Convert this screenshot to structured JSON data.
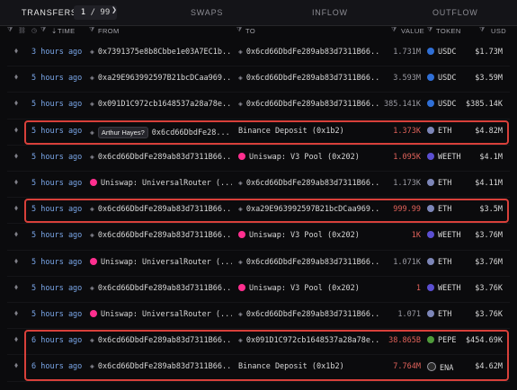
{
  "tabs": {
    "transfers": "TRANSFERS",
    "page_current": "1",
    "page_sep": " / ",
    "page_total": "99",
    "swaps": "SWAPS",
    "inflow": "INFLOW",
    "outflow": "OUTFLOW"
  },
  "header": {
    "time": "TIME",
    "from": "FROM",
    "to": "TO",
    "value": "VALUE",
    "token": "TOKEN",
    "usd": "USD"
  },
  "colors": {
    "link_blue": "#7aa6e8",
    "red": "#e0625a",
    "highlight": "#d8403a"
  },
  "rows": [
    {
      "time": "3 hours ago",
      "from": "0x7391375e8b8Cbbe1e03A7EC1b...",
      "from_tag": "",
      "from_icon": "",
      "to": "0x6cd66DbdFe289ab83d7311B66...",
      "to_icon": "",
      "value": "1.731M",
      "value_color": "grey",
      "token": "USDC",
      "token_icon": "usdc",
      "usd": "$1.73M"
    },
    {
      "time": "5 hours ago",
      "from": "0xa29E963992597B21bcDCaa969...",
      "from_tag": "",
      "from_icon": "",
      "to": "0x6cd66DbdFe289ab83d7311B66...",
      "to_icon": "",
      "value": "3.593M",
      "value_color": "grey",
      "token": "USDC",
      "token_icon": "usdc",
      "usd": "$3.59M"
    },
    {
      "time": "5 hours ago",
      "from": "0x091D1C972cb1648537a28a78e...",
      "from_tag": "",
      "from_icon": "",
      "to": "0x6cd66DbdFe289ab83d7311B66...",
      "to_icon": "",
      "value": "385.141K",
      "value_color": "grey",
      "token": "USDC",
      "token_icon": "usdc",
      "usd": "$385.14K"
    },
    {
      "time": "5 hours ago",
      "from": "0x6cd66DbdFe28...",
      "from_tag": "Arthur Hayes?",
      "from_icon": "",
      "to": "Binance Deposit (0x1b2)",
      "to_icon": "",
      "value": "1.373K",
      "value_color": "red",
      "token": "ETH",
      "token_icon": "eth",
      "usd": "$4.82M"
    },
    {
      "time": "5 hours ago",
      "from": "0x6cd66DbdFe289ab83d7311B66...",
      "from_tag": "",
      "from_icon": "",
      "to": "Uniswap: V3 Pool (0x202)",
      "to_icon": "uni",
      "value": "1.095K",
      "value_color": "red",
      "token": "WEETH",
      "token_icon": "weeth",
      "usd": "$4.1M"
    },
    {
      "time": "5 hours ago",
      "from": "Uniswap: UniversalRouter (...",
      "from_tag": "",
      "from_icon": "uni",
      "to": "0x6cd66DbdFe289ab83d7311B66...",
      "to_icon": "",
      "value": "1.173K",
      "value_color": "grey",
      "token": "ETH",
      "token_icon": "eth",
      "usd": "$4.11M"
    },
    {
      "time": "5 hours ago",
      "from": "0x6cd66DbdFe289ab83d7311B66...",
      "from_tag": "",
      "from_icon": "",
      "to": "0xa29E963992597B21bcDCaa969...",
      "to_icon": "",
      "value": "999.99",
      "value_color": "red",
      "token": "ETH",
      "token_icon": "eth",
      "usd": "$3.5M"
    },
    {
      "time": "5 hours ago",
      "from": "0x6cd66DbdFe289ab83d7311B66...",
      "from_tag": "",
      "from_icon": "",
      "to": "Uniswap: V3 Pool (0x202)",
      "to_icon": "uni",
      "value": "1K",
      "value_color": "red",
      "token": "WEETH",
      "token_icon": "weeth",
      "usd": "$3.76M"
    },
    {
      "time": "5 hours ago",
      "from": "Uniswap: UniversalRouter (...",
      "from_tag": "",
      "from_icon": "uni",
      "to": "0x6cd66DbdFe289ab83d7311B66...",
      "to_icon": "",
      "value": "1.071K",
      "value_color": "grey",
      "token": "ETH",
      "token_icon": "eth",
      "usd": "$3.76M"
    },
    {
      "time": "5 hours ago",
      "from": "0x6cd66DbdFe289ab83d7311B66...",
      "from_tag": "",
      "from_icon": "",
      "to": "Uniswap: V3 Pool (0x202)",
      "to_icon": "uni",
      "value": "1",
      "value_color": "red",
      "token": "WEETH",
      "token_icon": "weeth",
      "usd": "$3.76K"
    },
    {
      "time": "5 hours ago",
      "from": "Uniswap: UniversalRouter (...",
      "from_tag": "",
      "from_icon": "uni",
      "to": "0x6cd66DbdFe289ab83d7311B66...",
      "to_icon": "",
      "value": "1.071",
      "value_color": "grey",
      "token": "ETH",
      "token_icon": "eth",
      "usd": "$3.76K"
    },
    {
      "time": "6 hours ago",
      "from": "0x6cd66DbdFe289ab83d7311B66...",
      "from_tag": "",
      "from_icon": "",
      "to": "0x091D1C972cb1648537a28a78e...",
      "to_icon": "",
      "value": "38.865B",
      "value_color": "red",
      "token": "PEPE",
      "token_icon": "pepe",
      "usd": "$454.69K"
    },
    {
      "time": "6 hours ago",
      "from": "0x6cd66DbdFe289ab83d7311B66...",
      "from_tag": "",
      "from_icon": "",
      "to": "Binance Deposit (0x1b2)",
      "to_icon": "",
      "value": "7.764M",
      "value_color": "red",
      "token": "ENA",
      "token_icon": "ena",
      "usd": "$4.62M"
    }
  ],
  "highlights": [
    [
      3
    ],
    [
      6
    ],
    [
      11,
      12
    ]
  ]
}
